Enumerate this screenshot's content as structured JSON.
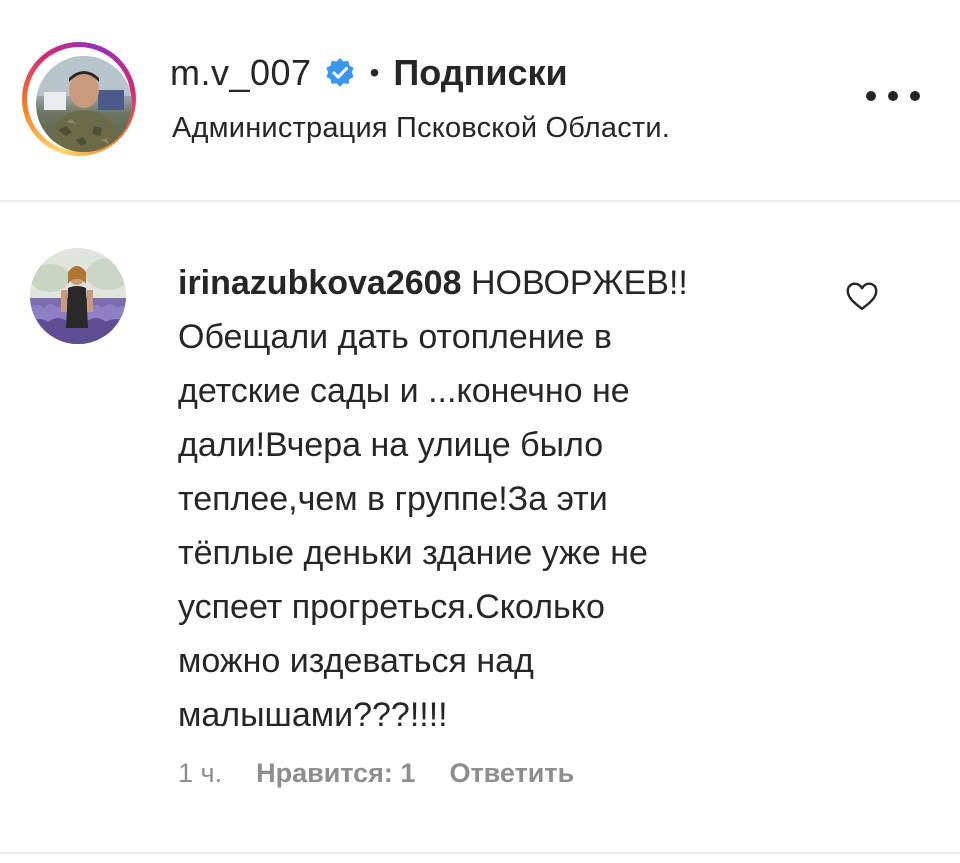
{
  "post_header": {
    "username": "m.v_007",
    "verified": true,
    "separator": "•",
    "follow_label": "Подписки",
    "subtitle": "Администрация Псковской Области.",
    "more_icon": "more-horizontal-icon"
  },
  "comment": {
    "username": "irinazubkova2608",
    "text_lines": [
      "НОВОРЖЕВ!!",
      "Обещали дать отопление в",
      "детские сады и ...конечно не",
      "дали!Вчера на улице было",
      "теплее,чем в группе!За эти",
      "тёплые деньки здание уже не",
      "успеет прогреться.Сколько",
      "можно издеваться над",
      "малышами???!!!!"
    ],
    "time": "1 ч.",
    "likes_label": "Нравится: 1",
    "reply_label": "Ответить",
    "like_icon": "heart-outline-icon"
  },
  "colors": {
    "text": "#262626",
    "muted": "#8e8e8e",
    "verified_blue": "#3897f0",
    "divider": "#ececec"
  }
}
